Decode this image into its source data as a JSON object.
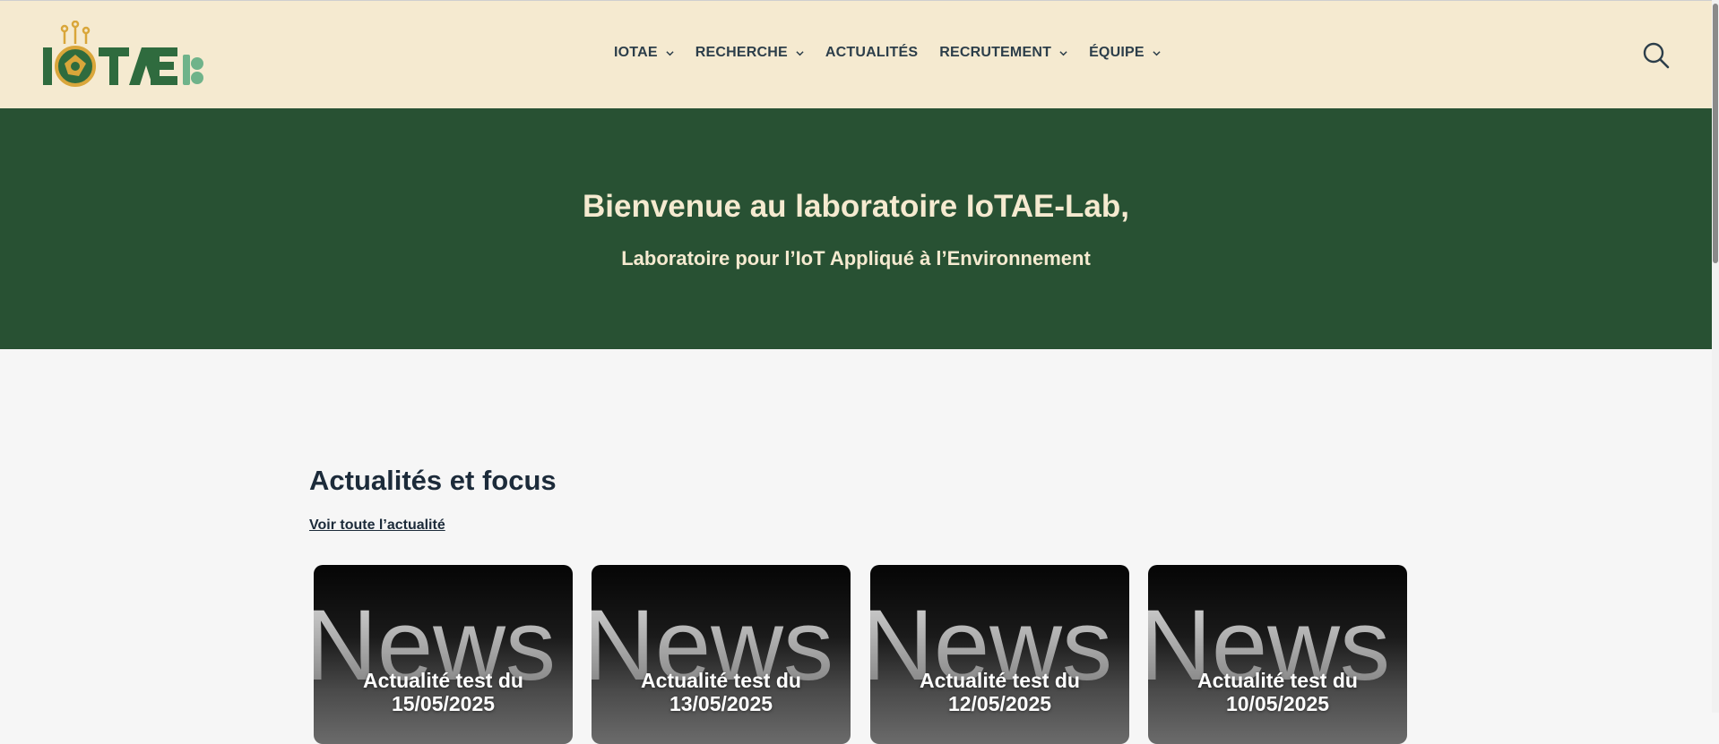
{
  "brand": {
    "logo_alt": "IoTAE Lab"
  },
  "nav": {
    "items": [
      {
        "label": "IOTAE",
        "has_dropdown": true
      },
      {
        "label": "RECHERCHE",
        "has_dropdown": true
      },
      {
        "label": "ACTUALITÉS",
        "has_dropdown": false
      },
      {
        "label": "RECRUTEMENT",
        "has_dropdown": true
      },
      {
        "label": "ÉQUIPE",
        "has_dropdown": true
      }
    ],
    "search_icon": "search-icon"
  },
  "hero": {
    "title": "Bienvenue au laboratoire IoTAE-Lab,",
    "subtitle": "Laboratoire pour l’IoT Appliqué à l’Environnement"
  },
  "news": {
    "section_title": "Actualités et focus",
    "see_all": "Voir toute l’actualité",
    "cards": [
      {
        "title": "Actualité test du 15/05/2025",
        "image_text": "News"
      },
      {
        "title": "Actualité test du 13/05/2025",
        "image_text": "News"
      },
      {
        "title": "Actualité test du 12/05/2025",
        "image_text": "News"
      },
      {
        "title": "Actualité test du 10/05/2025",
        "image_text": "News"
      }
    ]
  },
  "colors": {
    "header_bg": "#f5ead0",
    "hero_bg": "#285133",
    "accent_gold": "#d9a63a",
    "text_dark": "#1c2b3a"
  }
}
